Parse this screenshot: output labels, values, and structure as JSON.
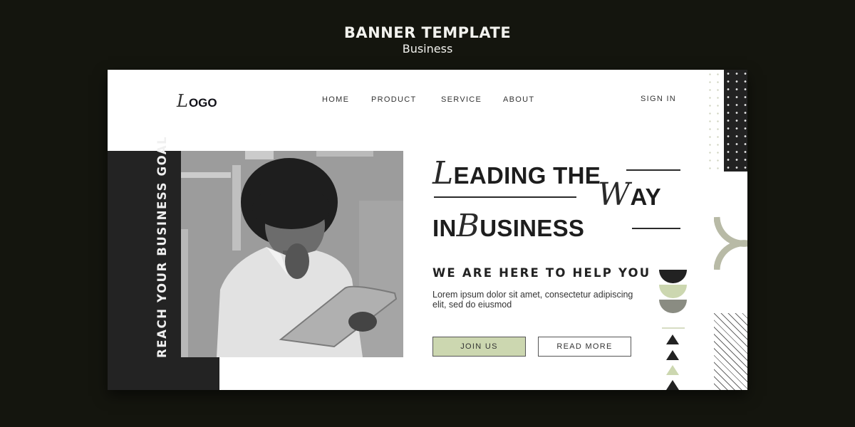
{
  "page_header": {
    "title": "BANNER TEMPLATE",
    "subtitle": "Business"
  },
  "banner": {
    "logo": {
      "script_letter": "L",
      "rest": "OGO"
    },
    "nav": {
      "items": [
        "HOME",
        "PRODUCT",
        "SERVICE",
        "ABOUT"
      ],
      "sign_in": "SIGN IN"
    },
    "vertical_text": "REACH YOUR BUSINESS GOAL",
    "photo_alt": "woman-with-tablet-photo",
    "headline": {
      "line1_script": "L",
      "line1_rest": "EADING THE",
      "line2_script": "W",
      "line2_rest": "AY",
      "line3_start": "IN",
      "line3_script": "B",
      "line3_rest": "USINESS"
    },
    "tagline": "WE ARE HERE TO HELP YOU",
    "body": "Lorem ipsum dolor sit amet, consectetur adipiscing elit, sed do eiusmod",
    "buttons": {
      "join": "JOIN US",
      "read_more": "READ MORE"
    },
    "colors": {
      "accent_green": "#ccd7b0",
      "sage": "#b8baa6",
      "dark": "#222222",
      "gray_green": "#8a8c82",
      "background": "#14150e"
    }
  }
}
